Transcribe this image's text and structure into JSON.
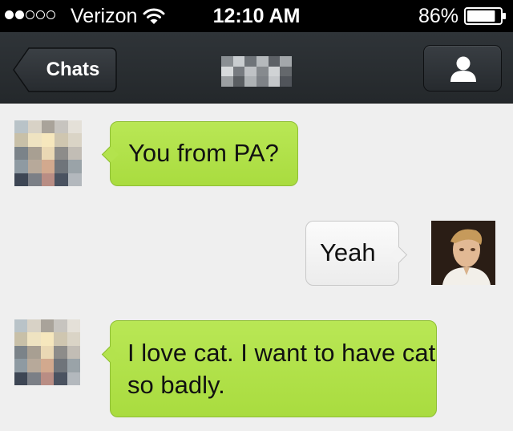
{
  "status_bar": {
    "signal_strength": 2,
    "signal_max": 5,
    "carrier": "Verizon",
    "time": "12:10 AM",
    "battery_percent": "86%",
    "battery_level": 0.86,
    "icons": [
      "signal-dots-icon",
      "wifi-icon",
      "battery-icon"
    ]
  },
  "nav": {
    "back_label": "Chats",
    "title_obscured": true,
    "contact_icon": "person-icon"
  },
  "messages": [
    {
      "direction": "incoming",
      "sender_avatar": "pixelated-avatar",
      "text": "You from PA?"
    },
    {
      "direction": "outgoing",
      "sender_avatar": "user-photo-avatar",
      "text": "Yeah"
    },
    {
      "direction": "incoming",
      "sender_avatar": "pixelated-avatar",
      "text": "I love cat. I want to have cat so badly."
    }
  ],
  "colors": {
    "status_bar_bg": "#000000",
    "nav_bar_bg": "#2b2f33",
    "chat_bg": "#efefef",
    "incoming_bubble": "#b3e34d",
    "outgoing_bubble": "#f3f3f3"
  }
}
